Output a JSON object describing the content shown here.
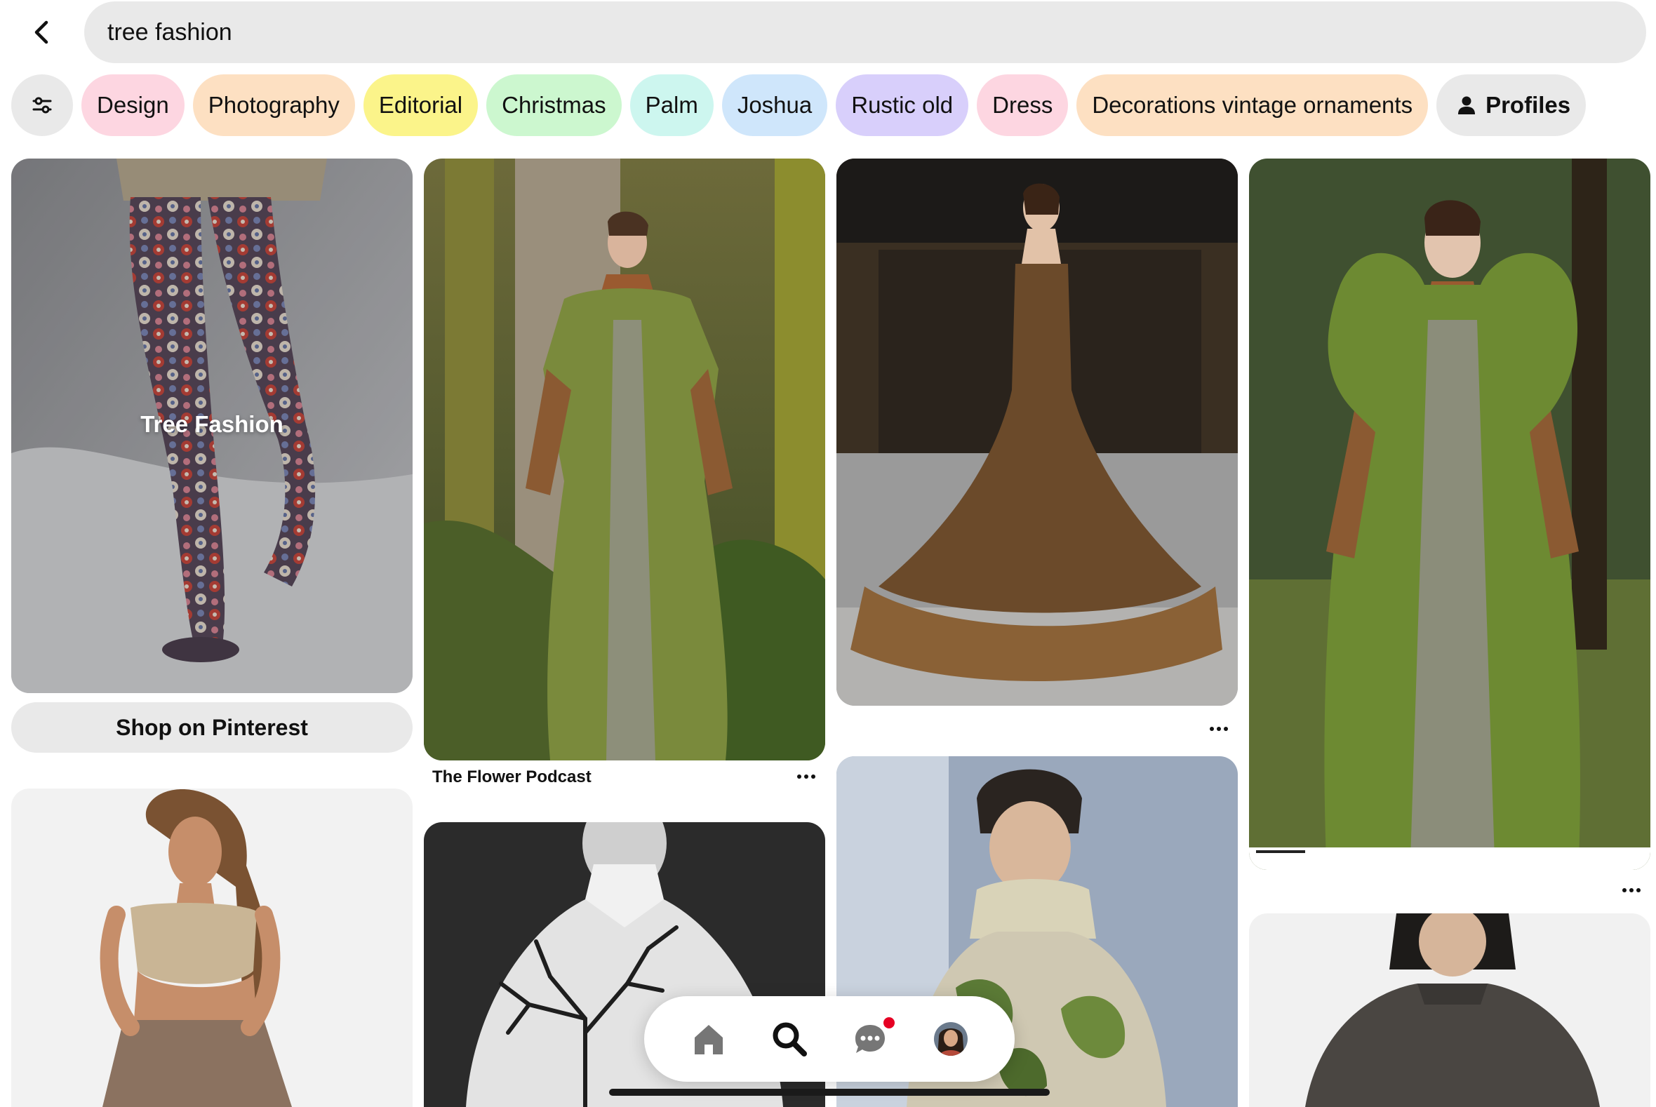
{
  "search": {
    "query": "tree fashion",
    "back_icon": "chevron-left-icon"
  },
  "filters": {
    "filter_icon": "sliders-icon",
    "chips": [
      {
        "label": "Design",
        "color": "#fdd6e1"
      },
      {
        "label": "Photography",
        "color": "#fde0c2"
      },
      {
        "label": "Editorial",
        "color": "#fbf48a"
      },
      {
        "label": "Christmas",
        "color": "#ccf7cf"
      },
      {
        "label": "Palm",
        "color": "#cdf6ef"
      },
      {
        "label": "Joshua",
        "color": "#cfe6fb"
      },
      {
        "label": "Rustic old",
        "color": "#d8cffb"
      },
      {
        "label": "Dress",
        "color": "#fdd6e1"
      },
      {
        "label": "Decorations vintage ornaments",
        "color": "#fde0c2"
      }
    ],
    "profiles_label": "Profiles",
    "profiles_icon": "person-icon"
  },
  "pins": {
    "collection": {
      "title": "Tree Fashion",
      "image": "floral-tights-legs-photo",
      "shop_label": "Shop on Pinterest"
    },
    "moss_dress": {
      "image": "moss-dress-forest-photo",
      "source": "The Flower Podcast"
    },
    "twig_gown": {
      "image": "twig-gown-photo"
    },
    "moss_coat": {
      "image": "moss-coat-photo"
    },
    "halter_model": {
      "image": "halter-top-model-photo"
    },
    "tree_shirt": {
      "image": "tree-print-shirt-photo"
    },
    "knit_sweater": {
      "image": "leaf-knit-sweater-photo"
    },
    "grey_sweater": {
      "image": "grey-knit-sweater-photo"
    }
  },
  "nav": {
    "items": [
      "home-icon",
      "search-icon",
      "messages-icon",
      "profile-avatar"
    ],
    "active": "search-icon",
    "notification": true
  },
  "colors": {
    "accent": "#e60023",
    "chip_neutral": "#e9e9e9"
  }
}
